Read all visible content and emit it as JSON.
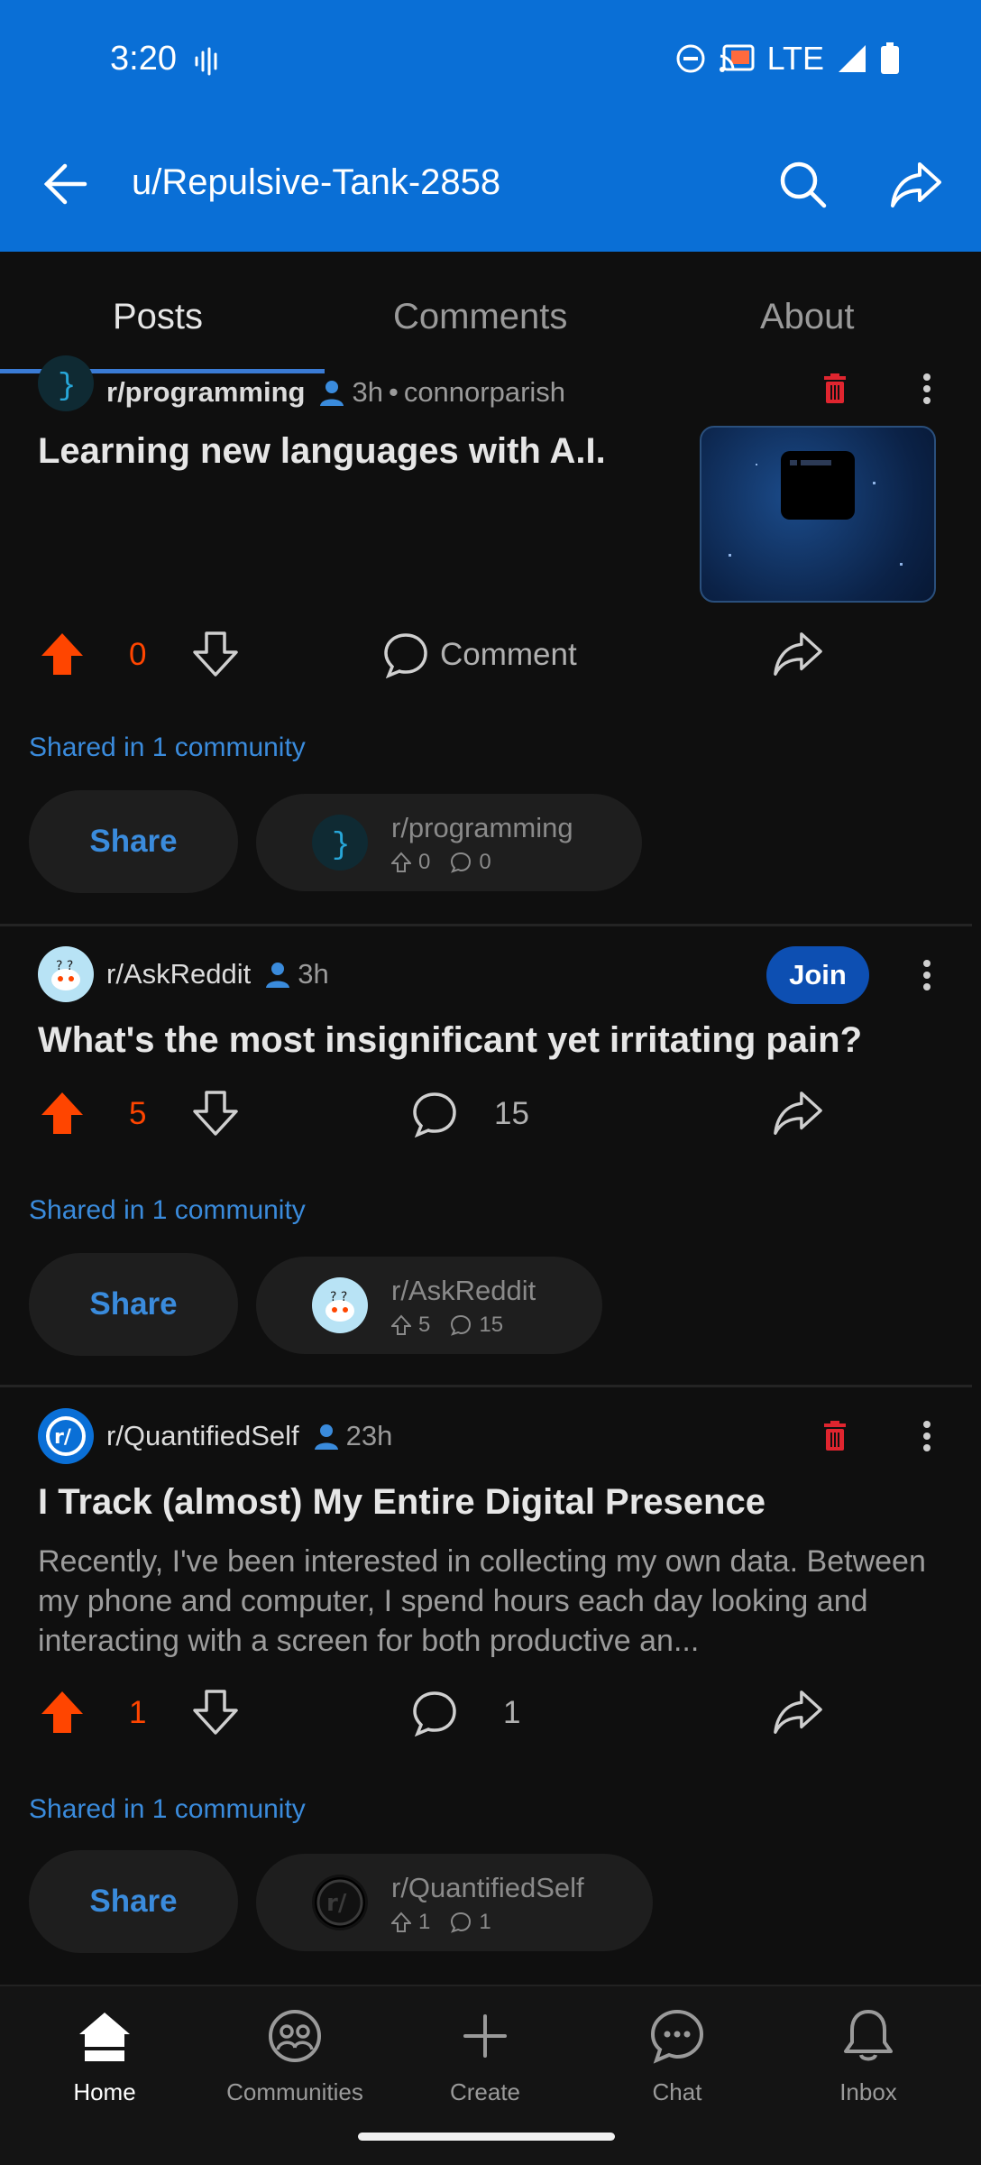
{
  "status_bar": {
    "time": "3:20",
    "network": "LTE"
  },
  "app_bar": {
    "title": "u/Repulsive-Tank-2858"
  },
  "tabs": [
    {
      "label": "Posts",
      "active": true
    },
    {
      "label": "Comments",
      "active": false
    },
    {
      "label": "About",
      "active": false
    }
  ],
  "posts": [
    {
      "subreddit": "r/programming",
      "age": "3h",
      "separator": "•",
      "author": "connorparish",
      "title": "Learning new languages with A.I.",
      "votes": "0",
      "comment_label": "Comment",
      "shared_label": "Shared in 1 community",
      "share_label": "Share",
      "chip": {
        "name": "r/programming",
        "upvotes": "0",
        "comments": "0"
      }
    },
    {
      "subreddit": "r/AskReddit",
      "age": "3h",
      "join_label": "Join",
      "title": "What's the most insignificant yet irritating pain?",
      "votes": "5",
      "comments": "15",
      "shared_label": "Shared in 1 community",
      "share_label": "Share",
      "chip": {
        "name": "r/AskReddit",
        "upvotes": "5",
        "comments": "15"
      }
    },
    {
      "subreddit": "r/QuantifiedSelf",
      "age": "23h",
      "title": "I Track (almost) My Entire Digital Presence",
      "body": "Recently, I've been interested in collecting my own data. Between my phone and computer, I spend hours each day looking and interacting with a screen for both productive an...",
      "votes": "1",
      "comments": "1",
      "shared_label": "Shared in 1 community",
      "share_label": "Share",
      "chip": {
        "name": "r/QuantifiedSelf",
        "upvotes": "1",
        "comments": "1"
      }
    }
  ],
  "bottom_nav": [
    {
      "label": "Home",
      "icon": "home-icon",
      "active": true
    },
    {
      "label": "Communities",
      "icon": "communities-icon",
      "active": false
    },
    {
      "label": "Create",
      "icon": "plus-icon",
      "active": false
    },
    {
      "label": "Chat",
      "icon": "chat-icon",
      "active": false
    },
    {
      "label": "Inbox",
      "icon": "bell-icon",
      "active": false
    }
  ],
  "colors": {
    "app_bar": "#0a6fd6",
    "upvote": "#ff4500",
    "link": "#3a8bdc",
    "delete": "#e0252f",
    "background": "#0f0f0f"
  }
}
